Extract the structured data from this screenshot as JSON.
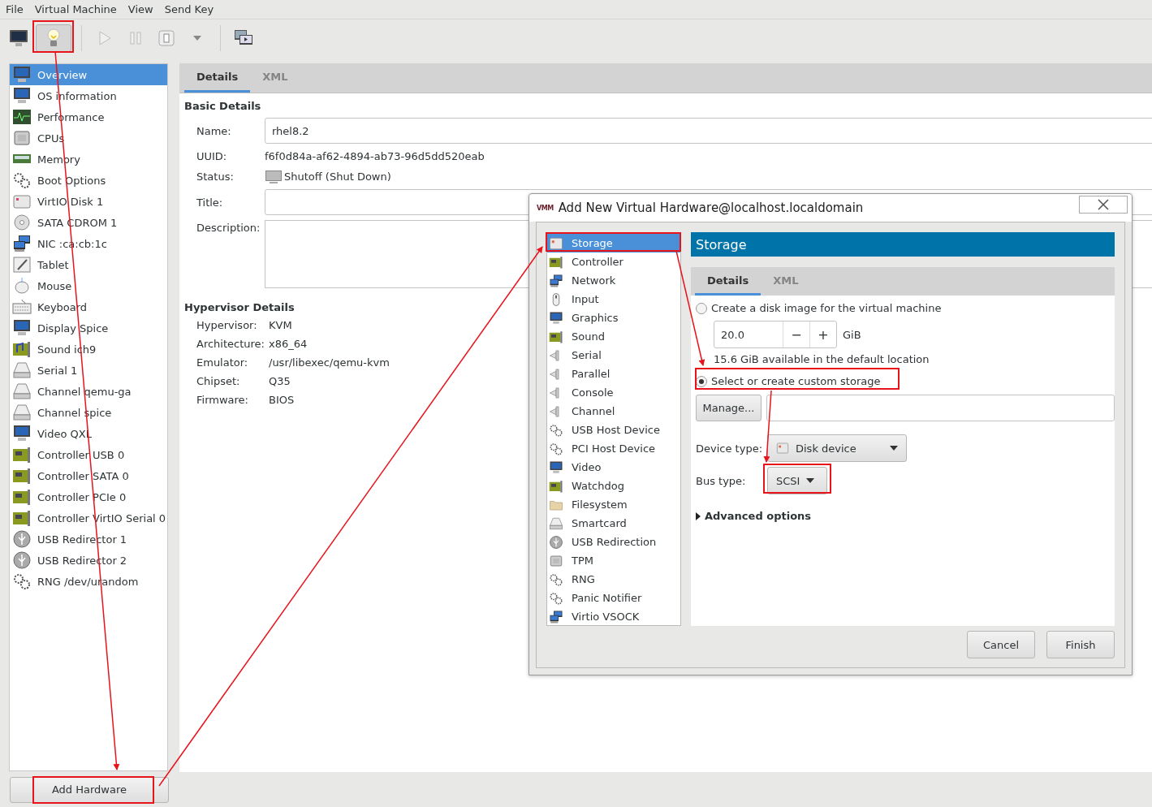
{
  "menu": [
    "File",
    "Virtual Machine",
    "View",
    "Send Key"
  ],
  "toolbar": [
    {
      "kind": "monitor",
      "selected": false,
      "disabled": false
    },
    {
      "kind": "bulb",
      "selected": true,
      "disabled": false
    },
    {
      "kind": "play",
      "selected": false,
      "disabled": true
    },
    {
      "kind": "pause",
      "selected": false,
      "disabled": true
    },
    {
      "kind": "power",
      "selected": false,
      "disabled": false
    },
    {
      "kind": "caret",
      "selected": false,
      "disabled": false
    },
    {
      "kind": "screens",
      "selected": false,
      "disabled": false
    }
  ],
  "sidebar": {
    "items": [
      {
        "label": "Overview",
        "kind": "monitor",
        "selected": true
      },
      {
        "label": "OS information",
        "kind": "monitor",
        "selected": false
      },
      {
        "label": "Performance",
        "kind": "chart",
        "selected": false
      },
      {
        "label": "CPUs",
        "kind": "chip",
        "selected": false
      },
      {
        "label": "Memory",
        "kind": "memory",
        "selected": false
      },
      {
        "label": "Boot Options",
        "kind": "gears",
        "selected": false
      },
      {
        "label": "VirtIO Disk 1",
        "kind": "disk",
        "selected": false
      },
      {
        "label": "SATA CDROM 1",
        "kind": "cdrom",
        "selected": false
      },
      {
        "label": "NIC :ca:cb:1c",
        "kind": "network",
        "selected": false
      },
      {
        "label": "Tablet",
        "kind": "tablet",
        "selected": false
      },
      {
        "label": "Mouse",
        "kind": "mouse",
        "selected": false
      },
      {
        "label": "Keyboard",
        "kind": "keyboard",
        "selected": false
      },
      {
        "label": "Display Spice",
        "kind": "monitor",
        "selected": false
      },
      {
        "label": "Sound ich9",
        "kind": "soundcard",
        "selected": false
      },
      {
        "label": "Serial 1",
        "kind": "connector",
        "selected": false
      },
      {
        "label": "Channel qemu-ga",
        "kind": "connector",
        "selected": false
      },
      {
        "label": "Channel spice",
        "kind": "connector",
        "selected": false
      },
      {
        "label": "Video QXL",
        "kind": "monitor",
        "selected": false
      },
      {
        "label": "Controller USB 0",
        "kind": "card",
        "selected": false
      },
      {
        "label": "Controller SATA 0",
        "kind": "card",
        "selected": false
      },
      {
        "label": "Controller PCIe 0",
        "kind": "card",
        "selected": false
      },
      {
        "label": "Controller VirtIO Serial 0",
        "kind": "card",
        "selected": false
      },
      {
        "label": "USB Redirector 1",
        "kind": "usb",
        "selected": false
      },
      {
        "label": "USB Redirector 2",
        "kind": "usb",
        "selected": false
      },
      {
        "label": "RNG /dev/urandom",
        "kind": "gears",
        "selected": false
      }
    ],
    "add_button": "Add Hardware"
  },
  "details": {
    "tabs": [
      {
        "label": "Details",
        "selected": true
      },
      {
        "label": "XML",
        "selected": false
      }
    ],
    "basic": {
      "heading": "Basic Details",
      "fields": [
        {
          "label": "Name:",
          "kind": "input",
          "value": "rhel8.2"
        },
        {
          "label": "UUID:",
          "kind": "text",
          "value": "f6f0d84a-af62-4894-ab73-96d5dd520eab"
        },
        {
          "label": "Status:",
          "kind": "status",
          "value": "Shutoff (Shut Down)"
        },
        {
          "label": "Title:",
          "kind": "input"
        },
        {
          "label": "Description:",
          "kind": "textarea"
        }
      ]
    },
    "hypervisor": {
      "heading": "Hypervisor Details",
      "rows": [
        {
          "label": "Hypervisor:",
          "value": "KVM"
        },
        {
          "label": "Architecture:",
          "value": "x86_64"
        },
        {
          "label": "Emulator:",
          "value": "/usr/libexec/qemu-kvm"
        },
        {
          "label": "Chipset:",
          "value": "Q35"
        },
        {
          "label": "Firmware:",
          "value": "BIOS"
        }
      ]
    }
  },
  "dialog": {
    "logo": "VMM",
    "title": "Add New Virtual Hardware@localhost.localdomain",
    "categories": [
      {
        "label": "Storage",
        "kind": "disk",
        "selected": true
      },
      {
        "label": "Controller",
        "kind": "card",
        "selected": false
      },
      {
        "label": "Network",
        "kind": "network",
        "selected": false
      },
      {
        "label": "Input",
        "kind": "mouse",
        "selected": false
      },
      {
        "label": "Graphics",
        "kind": "monitor",
        "selected": false
      },
      {
        "label": "Sound",
        "kind": "card",
        "selected": false
      },
      {
        "label": "Serial",
        "kind": "plug",
        "selected": false
      },
      {
        "label": "Parallel",
        "kind": "plug",
        "selected": false
      },
      {
        "label": "Console",
        "kind": "plug",
        "selected": false
      },
      {
        "label": "Channel",
        "kind": "plug",
        "selected": false
      },
      {
        "label": "USB Host Device",
        "kind": "gears",
        "selected": false
      },
      {
        "label": "PCI Host Device",
        "kind": "gears",
        "selected": false
      },
      {
        "label": "Video",
        "kind": "monitor",
        "selected": false
      },
      {
        "label": "Watchdog",
        "kind": "card",
        "selected": false
      },
      {
        "label": "Filesystem",
        "kind": "folder",
        "selected": false
      },
      {
        "label": "Smartcard",
        "kind": "connector",
        "selected": false
      },
      {
        "label": "USB Redirection",
        "kind": "usb",
        "selected": false
      },
      {
        "label": "TPM",
        "kind": "chip",
        "selected": false
      },
      {
        "label": "RNG",
        "kind": "gears",
        "selected": false
      },
      {
        "label": "Panic Notifier",
        "kind": "gears",
        "selected": false
      },
      {
        "label": "Virtio VSOCK",
        "kind": "network",
        "selected": false
      }
    ],
    "panel": {
      "header": "Storage",
      "tabs": [
        {
          "label": "Details",
          "selected": true
        },
        {
          "label": "XML",
          "selected": false
        }
      ],
      "create_option": {
        "label": "Create a disk image for the virtual machine",
        "selected": false
      },
      "size": {
        "value": "20.0",
        "minus": "−",
        "plus": "+",
        "unit": "GiB"
      },
      "available": "15.6 GiB available in the default location",
      "custom_option": {
        "label": "Select or create custom storage",
        "selected": true
      },
      "manage_button": "Manage...",
      "device_type": {
        "label": "Device type:",
        "value": "Disk device",
        "kind": "disk"
      },
      "bus_type": {
        "label": "Bus type:",
        "value": "SCSI"
      },
      "advanced": {
        "label": "Advanced options",
        "expanded": false
      }
    },
    "buttons": [
      "Cancel",
      "Finish"
    ]
  }
}
